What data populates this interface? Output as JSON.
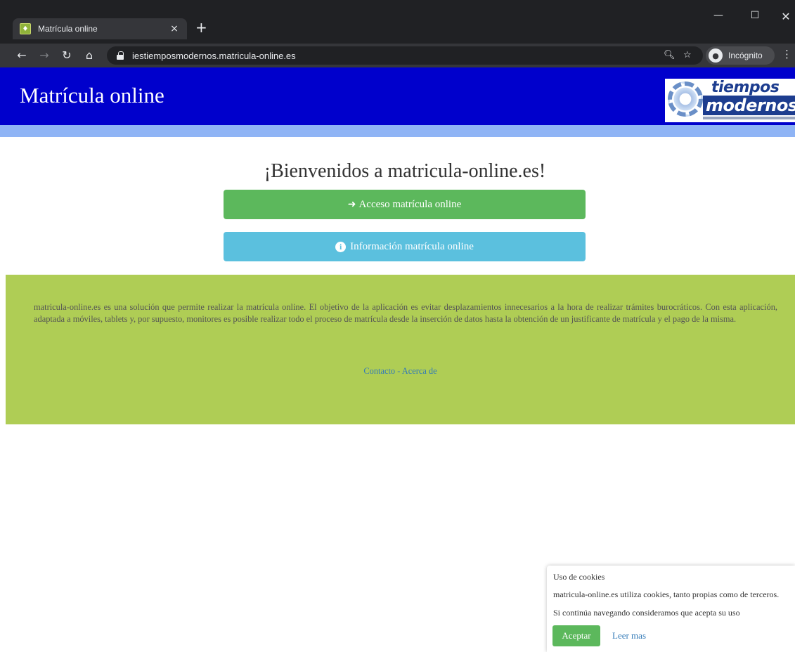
{
  "browser": {
    "tab": {
      "title": "Matrícula online",
      "close_icon": "×"
    },
    "new_tab_icon": "+",
    "window_controls": {
      "minimize": "—",
      "maximize": "☐",
      "close": "✕"
    },
    "nav": {
      "back": "←",
      "forward": "→",
      "reload": "↻",
      "home": "⌂"
    },
    "url": "iestiemposmodernos.matricula-online.es",
    "zoom_icon": "🔍︎",
    "star_icon": "☆",
    "profile_label": "Incógnito",
    "menu_icon": "⋮"
  },
  "header": {
    "title": "Matrícula online",
    "logo": {
      "word1": "tiempos",
      "word2": "modernos"
    }
  },
  "main": {
    "welcome": "¡Bienvenidos a matricula-online.es!",
    "access_button": "Acceso matrícula online",
    "info_button": "Información matrícula online"
  },
  "footer": {
    "description": "matricula-online.es es una solución que permite realizar la matrícula online. El objetivo de la aplicación es evitar desplazamientos innecesarios a la hora de realizar trámites burocráticos. Con esta aplicación, adaptada a móviles, tablets y, por supuesto, monitores es posible realizar todo el proceso de matrícula desde la inserción de datos hasta la obtención de un justificante de matrícula y el pago de la misma.",
    "contact_link": "Contacto",
    "separator": " - ",
    "about_link": "Acerca de"
  },
  "cookie_notice": {
    "title": "Uso de cookies",
    "line1": "matricula-online.es utiliza cookies, tanto propias como de terceros.",
    "line2": "Si continúa navegando consideramos que acepta su uso",
    "accept_button": "Aceptar",
    "read_more_link": "Leer mas"
  },
  "colors": {
    "header_bg": "#0000cc",
    "accent_band": "#8fb4f5",
    "access_button": "#5cb85c",
    "info_button": "#5bc0de",
    "footer_bg": "#afcd55",
    "link": "#337ab7"
  }
}
